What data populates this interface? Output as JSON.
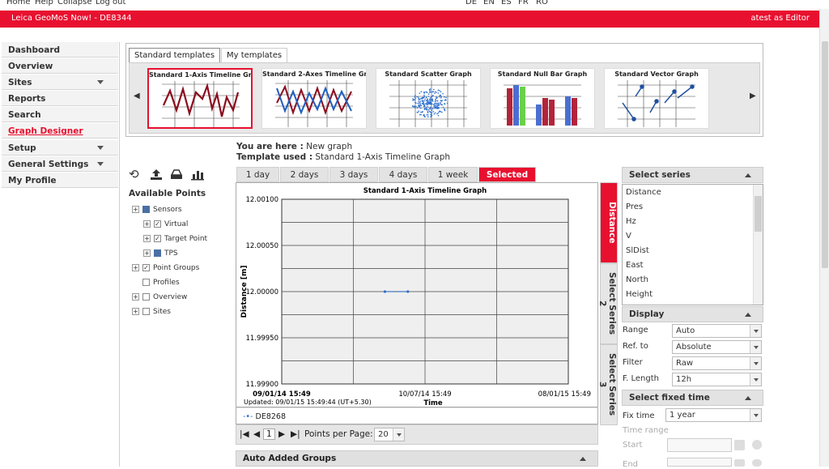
{
  "topnav": [
    "Home",
    "Help",
    "Collapse",
    "Log out"
  ],
  "languages": [
    "DE",
    "EN",
    "ES",
    "FR",
    "RO"
  ],
  "app": {
    "title": "Leica GeoMoS Now!  - DE8344",
    "user": "atest as Editor"
  },
  "sidebar": [
    {
      "label": "Dashboard",
      "expand": false
    },
    {
      "label": "Overview",
      "expand": false
    },
    {
      "label": "Sites",
      "expand": true
    },
    {
      "label": "Reports",
      "expand": false
    },
    {
      "label": "Search",
      "expand": false
    },
    {
      "label": "Graph Designer",
      "expand": false,
      "active": true
    },
    {
      "label": "Setup",
      "expand": true
    },
    {
      "label": "General Settings",
      "expand": true
    },
    {
      "label": "My Profile",
      "expand": false
    }
  ],
  "template_tabs": [
    "Standard templates",
    "My templates"
  ],
  "templates": [
    "Standard 1-Axis Timeline Gra...",
    "Standard 2-Axes Timeline Gr...",
    "Standard Scatter Graph",
    "Standard Null Bar Graph",
    "Standard Vector Graph"
  ],
  "info": {
    "here_label": "You are here :",
    "here_value": "New graph",
    "tpl_label": "Template used :",
    "tpl_value": "Standard 1-Axis Timeline Graph"
  },
  "available_points": {
    "title": "Available Points",
    "tree": [
      {
        "label": "Sensors",
        "level": 0,
        "expander": "+",
        "check": "partial"
      },
      {
        "label": "Virtual",
        "level": 1,
        "expander": "+",
        "check": "checked"
      },
      {
        "label": "Target Point",
        "level": 1,
        "expander": "+",
        "check": "checked"
      },
      {
        "label": "TPS",
        "level": 1,
        "expander": "+",
        "check": "partial"
      },
      {
        "label": "Point Groups",
        "level": 0,
        "expander": "+",
        "check": "checked"
      },
      {
        "label": "Profiles",
        "level": 0,
        "expander": "",
        "check": "unchecked"
      },
      {
        "label": "Overview",
        "level": 0,
        "expander": "+",
        "check": "unchecked"
      },
      {
        "label": "Sites",
        "level": 0,
        "expander": "+",
        "check": "unchecked"
      }
    ]
  },
  "ranges": [
    {
      "label": "1 day"
    },
    {
      "label": "2 days"
    },
    {
      "label": "3 days"
    },
    {
      "label": "4 days"
    },
    {
      "label": "1 week"
    },
    {
      "label": "Selected",
      "selected": true
    }
  ],
  "chart_data": {
    "type": "line",
    "title": "Standard 1-Axis Timeline Graph",
    "xlabel": "Time",
    "ylabel": "Distance [m]",
    "ylim": [
      11.999,
      12.001
    ],
    "yticks": [
      "12.00100",
      "12.00050",
      "12.00000",
      "11.99950",
      "11.99900"
    ],
    "xticks": [
      "09/01/14 15:49",
      "10/07/14 15:49",
      "08/01/15 15:49"
    ],
    "series": [
      {
        "name": "DE8268",
        "color": "#2a6fd0",
        "x": [
          0.36,
          0.44
        ],
        "y": [
          12.0,
          12.0
        ]
      }
    ],
    "grid": true,
    "updated": "Updated: 09/01/15 15:49:44 (UT+5.30)"
  },
  "pager": {
    "page": "1",
    "per_page_label": "Points per Page:",
    "per_page": "20"
  },
  "auto_groups": "Auto Added Groups",
  "vtabs": [
    {
      "label": "Distance",
      "selected": true
    },
    {
      "label": "Select Series 2"
    },
    {
      "label": "Select Series 3"
    }
  ],
  "select_series": {
    "title": "Select series",
    "items": [
      "Distance",
      "Pres",
      "Hz",
      "V",
      "SlDist",
      "East",
      "North",
      "Height"
    ]
  },
  "display": {
    "title": "Display",
    "fields": [
      {
        "label": "Range",
        "value": "Auto"
      },
      {
        "label": "Ref. to",
        "value": "Absolute"
      },
      {
        "label": "Filter",
        "value": "Raw"
      },
      {
        "label": "F. Length",
        "value": "12h"
      }
    ]
  },
  "fixed_time": {
    "title": "Select fixed time",
    "fix_label": "Fix time",
    "fix_value": "1 year",
    "range_label": "Time range",
    "start_label": "Start",
    "end_label": "End"
  }
}
